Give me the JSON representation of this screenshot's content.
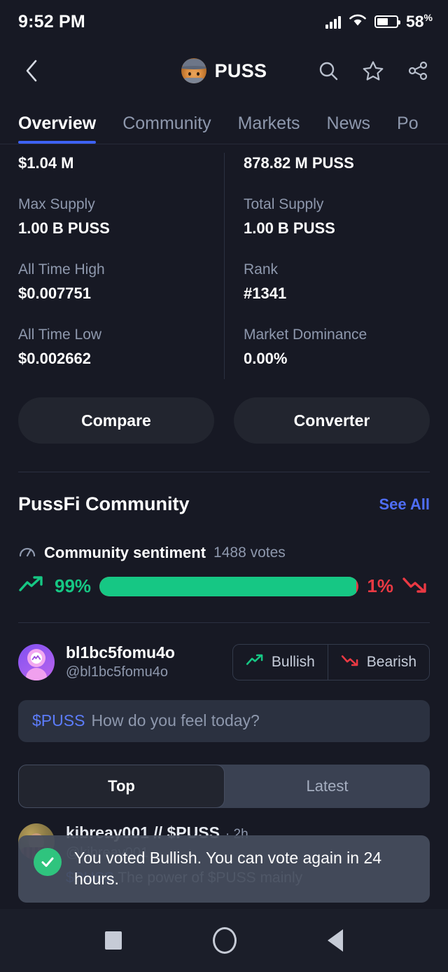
{
  "status_bar": {
    "time": "9:52 PM",
    "battery_percent": "58",
    "percent_symbol": "%",
    "signal_icon": "cellular-signal-icon",
    "wifi_icon": "wifi-icon",
    "battery_icon": "battery-icon"
  },
  "header": {
    "back_icon": "chevron-left-icon",
    "coin_avatar_icon": "puss-cat-avatar",
    "title": "PUSS",
    "search_icon": "search-icon",
    "favorite_icon": "star-icon",
    "share_icon": "share-icon"
  },
  "tabs": [
    {
      "label": "Overview",
      "active": true
    },
    {
      "label": "Community",
      "active": false
    },
    {
      "label": "Markets",
      "active": false
    },
    {
      "label": "News",
      "active": false
    },
    {
      "label": "Po",
      "active": false
    }
  ],
  "stats": {
    "left": [
      {
        "label": "",
        "value": "$1.04 M"
      },
      {
        "label": "Max Supply",
        "value": "1.00 B PUSS"
      },
      {
        "label": "All Time High",
        "value": "$0.007751"
      },
      {
        "label": "All Time Low",
        "value": "$0.002662"
      }
    ],
    "right": [
      {
        "label": "",
        "value": "878.82 M PUSS"
      },
      {
        "label": "Total Supply",
        "value": "1.00 B PUSS"
      },
      {
        "label": "Rank",
        "value": "#1341"
      },
      {
        "label": "Market Dominance",
        "value": "0.00%"
      }
    ]
  },
  "actions": {
    "compare": "Compare",
    "converter": "Converter"
  },
  "community": {
    "title": "PussFi Community",
    "see_all": "See All",
    "sentiment": {
      "gauge_icon": "gauge-icon",
      "label": "Community sentiment",
      "votes": "1488 votes",
      "bullish_percent": "99%",
      "bearish_percent": "1%",
      "bullish_value": 99,
      "bearish_value": 1,
      "bullish_icon": "trend-up-icon",
      "bearish_icon": "trend-down-icon",
      "bullish_color": "#16c784",
      "bearish_color": "#ea3943"
    },
    "current_user": {
      "avatar_icon": "user-avatar-icon",
      "name": "bl1bc5fomu4o",
      "handle": "@bl1bc5fomu4o",
      "bullish_label": "Bullish",
      "bearish_label": "Bearish",
      "bullish_icon": "trend-up-icon",
      "bearish_icon": "trend-down-icon"
    },
    "composer": {
      "ticker": "$PUSS",
      "placeholder": "How do you feel today?"
    },
    "feed_tabs": [
      {
        "label": "Top",
        "active": true
      },
      {
        "label": "Latest",
        "active": false
      }
    ],
    "posts": [
      {
        "avatar_icon": "user-photo-avatar",
        "author": "kibreay001 // $PUSS",
        "time": "· 2h",
        "handle": "@kibreay001",
        "body_ticker": "$PUSS",
        "body": "The power of $PUSS mainly"
      }
    ]
  },
  "toast": {
    "check_icon": "check-circle-icon",
    "message": "You voted Bullish. You can vote again in 24 hours."
  },
  "navbar": {
    "recents_icon": "square-recents-icon",
    "home_icon": "circle-home-icon",
    "back_icon": "triangle-back-icon"
  }
}
